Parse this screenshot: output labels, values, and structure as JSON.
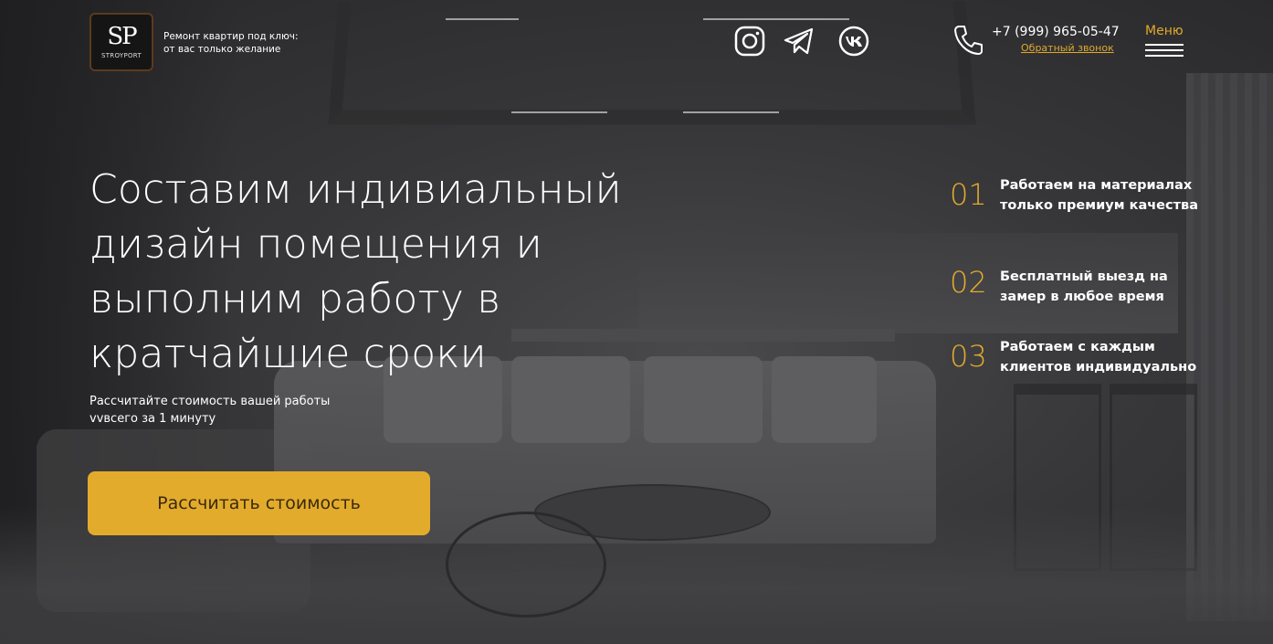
{
  "header": {
    "logo": {
      "mark": "SP",
      "name": "STROYPORT"
    },
    "tagline": "Ремонт квартир под ключ:\nот вас только желание",
    "socials": [
      {
        "icon": "instagram-icon"
      },
      {
        "icon": "telegram-icon"
      },
      {
        "icon": "vk-icon"
      }
    ],
    "phone_icon": "phone-icon",
    "phone": "+7 (999) 965-05-47",
    "callback_label": "Обратный звонок",
    "menu_label": "Меню"
  },
  "main": {
    "headline": "Составим индивиальный дизайн помещения и выполним работу в кратчайшие сроки",
    "subtitle": "Рассчитайте стоимость вашей работы\nvvвсего за 1 минуту",
    "cta_label": "Рассчитать стоимость"
  },
  "features": [
    {
      "num": "01",
      "text": "Работаем на материалах\nтолько премиум качества"
    },
    {
      "num": "02",
      "text": "Бесплатный выезд на\nзамер в любое время"
    },
    {
      "num": "03",
      "text": "Работаем с каждым\nклиентов индивидуально"
    }
  ],
  "colors": {
    "accent": "#e3ab2c",
    "link": "#e0a92c",
    "background": "#3a3a3c",
    "logo_border": "#5c3a1e"
  }
}
